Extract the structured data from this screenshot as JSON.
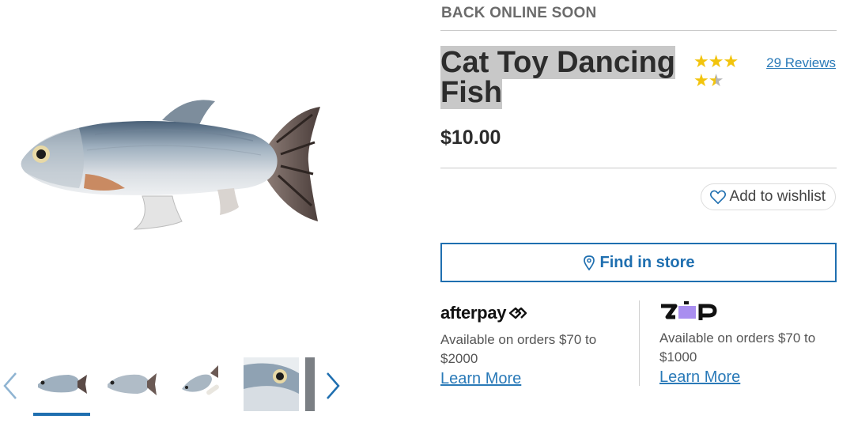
{
  "product": {
    "availability": "BACK ONLINE SOON",
    "title": "Cat Toy Dancing Fish",
    "rating": 3.5,
    "rating_max": 5,
    "reviews_label": "29 Reviews",
    "price": "$10.00"
  },
  "actions": {
    "wishlist_label": "Add to wishlist",
    "find_store_label": "Find in store"
  },
  "payments": {
    "afterpay": {
      "logo_text": "afterpay",
      "description": "Available on orders $70 to $2000",
      "link": "Learn More"
    },
    "zip": {
      "logo_text": "zip",
      "description": "Available on orders $70 to $1000",
      "link": "Learn More"
    }
  },
  "gallery": {
    "thumbnail_count": 5,
    "active_index": 0
  },
  "colors": {
    "accent": "#1f6fb0",
    "link": "#2a7ab8",
    "star": "#f2c40d",
    "highlight": "#c8c8c8"
  }
}
